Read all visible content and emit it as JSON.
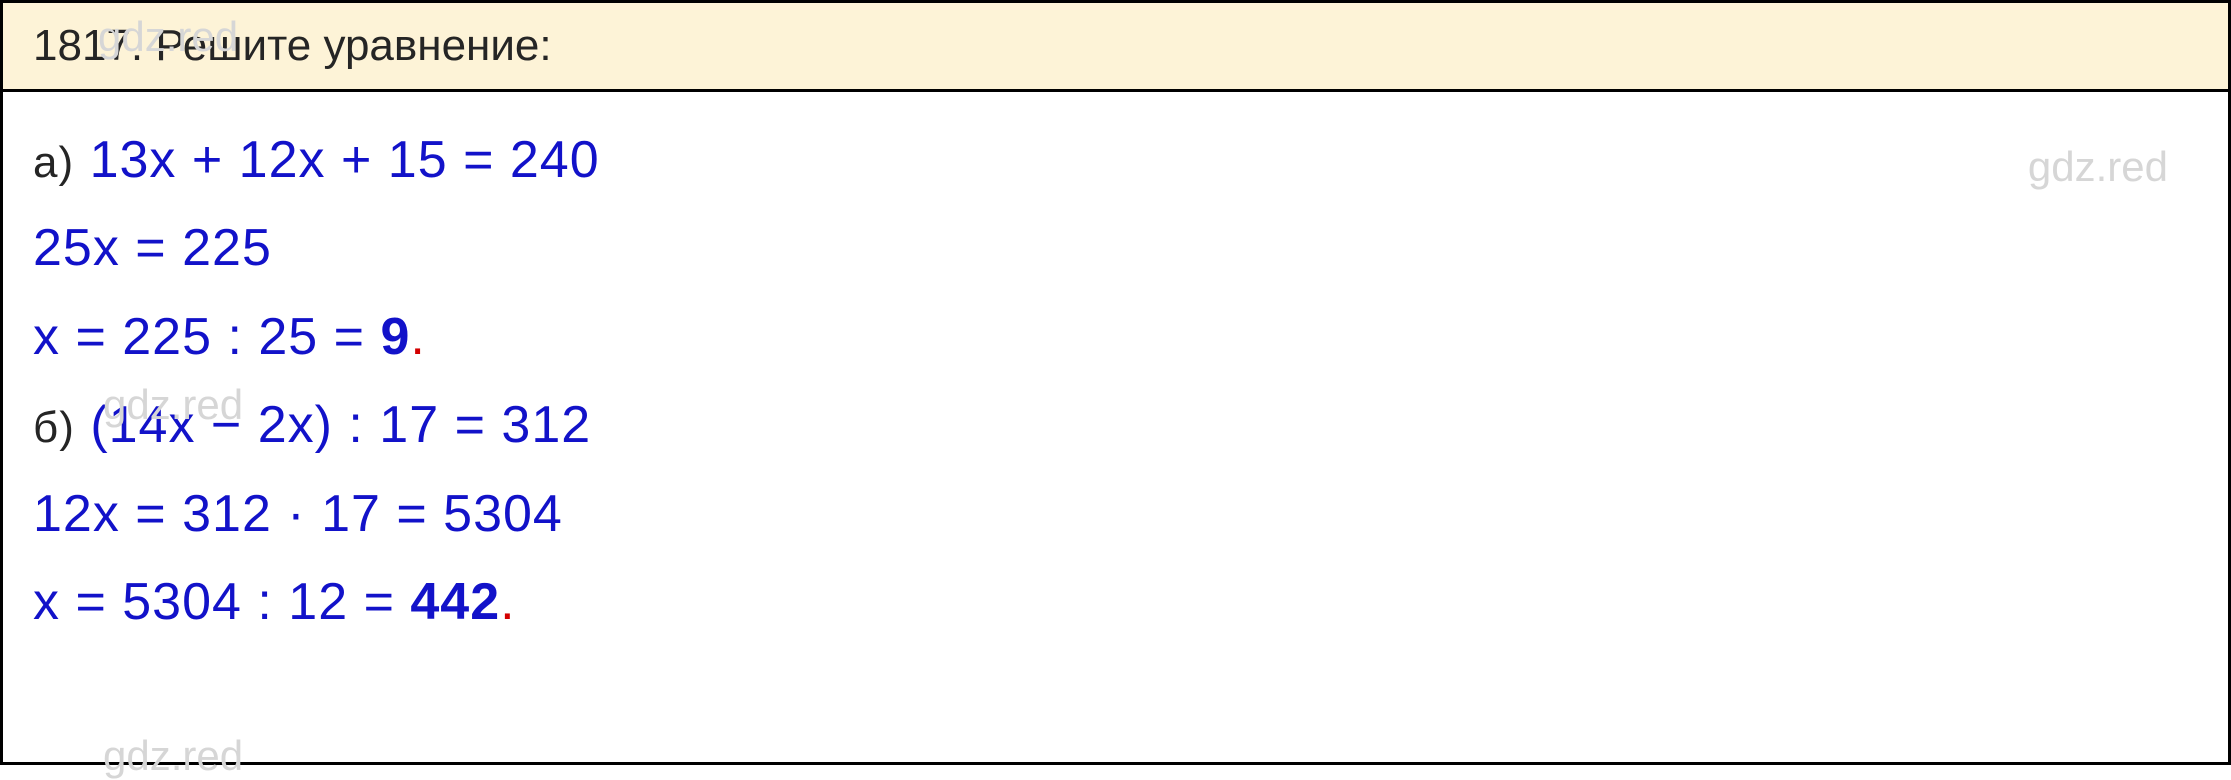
{
  "header": {
    "problem_number": "1817.",
    "title": "Решите уравнение:"
  },
  "watermarks": {
    "top": "gdz.red",
    "right": "gdz.red",
    "mid": "gdz.red",
    "bottom": "gdz.red"
  },
  "solutions": {
    "a": {
      "label": "а)",
      "line1": "13x + 12x + 15 = 240",
      "line2": "25x = 225",
      "line3_prefix": "x = 225 : 25 = ",
      "line3_answer": "9",
      "dot": "."
    },
    "b": {
      "label": "б)",
      "line1": "(14x − 2x) : 17 = 312",
      "line2": "12x = 312 · 17 = 5304",
      "line3_prefix": "x = 5304 : 12 = ",
      "line3_answer": "442",
      "dot": "."
    }
  }
}
